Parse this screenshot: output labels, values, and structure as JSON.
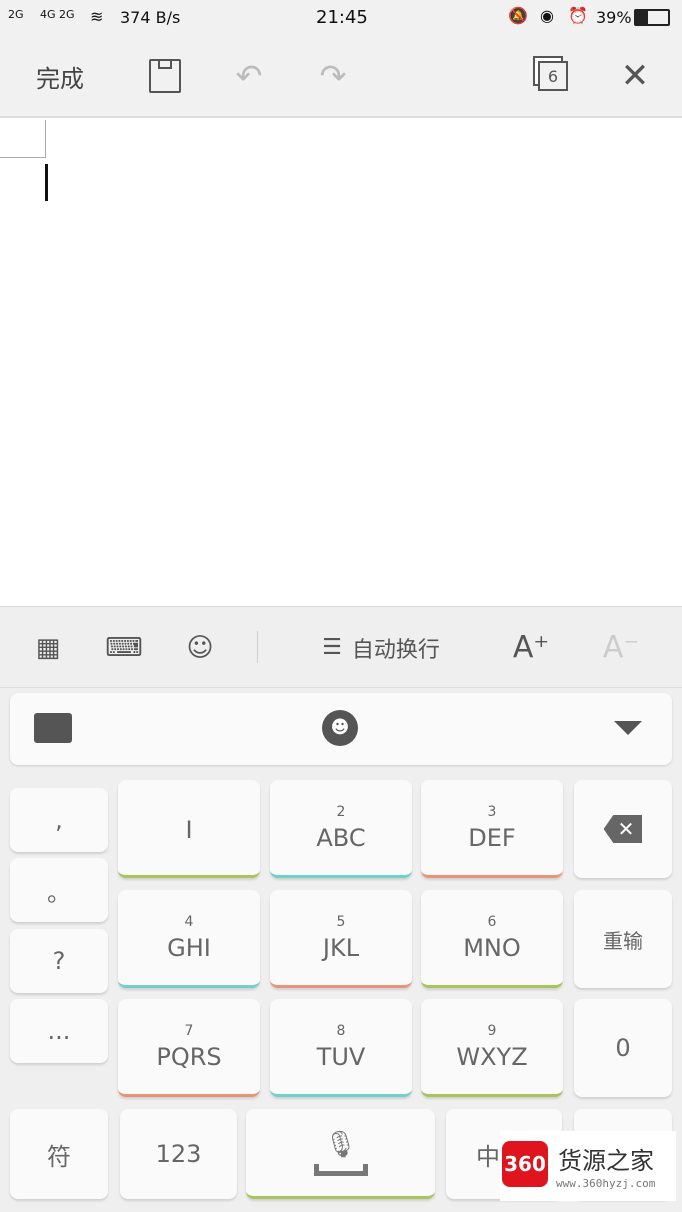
{
  "status": {
    "signal1": "2G",
    "signal2": "4G 2G",
    "speed": "374 B/s",
    "time": "21:45",
    "battery": "39%",
    "battery_level": 0.39
  },
  "toolbar": {
    "done": "完成",
    "tabs_count": "6"
  },
  "format_bar": {
    "wrap_label": "自动换行",
    "font_up": "A⁺",
    "font_down": "A⁻"
  },
  "keyboard": {
    "punct": [
      ",",
      "。",
      "?",
      "..."
    ],
    "keys": [
      {
        "num": "",
        "label": "I",
        "color": "#a8c45a"
      },
      {
        "num": "2",
        "label": "ABC",
        "color": "#6fd0cc"
      },
      {
        "num": "3",
        "label": "DEF",
        "color": "#e89478"
      },
      {
        "num": "4",
        "label": "GHI",
        "color": "#6fd0cc"
      },
      {
        "num": "5",
        "label": "JKL",
        "color": "#e89478"
      },
      {
        "num": "6",
        "label": "MNO",
        "color": "#a8c45a"
      },
      {
        "num": "7",
        "label": "PQRS",
        "color": "#e89478"
      },
      {
        "num": "8",
        "label": "TUV",
        "color": "#6fd0cc"
      },
      {
        "num": "9",
        "label": "WXYZ",
        "color": "#a8c45a"
      }
    ],
    "reenter": "重输",
    "zero": "0",
    "symbols": "符",
    "numbers": "123",
    "lang": "中"
  },
  "watermark": {
    "logo": "360",
    "name": "货源之家",
    "url": "www.360hyzj.com"
  }
}
